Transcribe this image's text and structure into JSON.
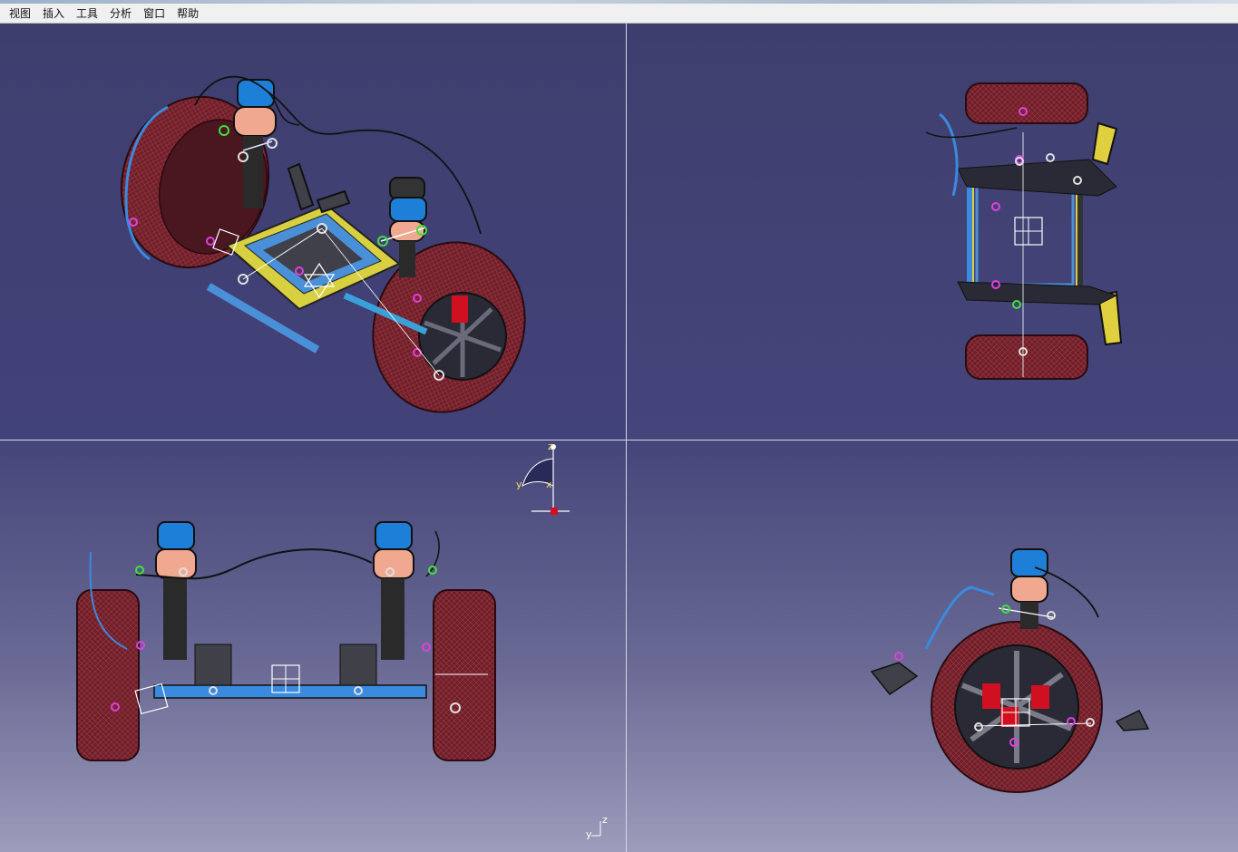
{
  "menu": {
    "items": [
      {
        "id": "view",
        "label": "视图"
      },
      {
        "id": "insert",
        "label": "插入"
      },
      {
        "id": "tools",
        "label": "工具"
      },
      {
        "id": "analyze",
        "label": "分析"
      },
      {
        "id": "window",
        "label": "窗口"
      },
      {
        "id": "help",
        "label": "帮助"
      }
    ]
  },
  "compass": {
    "z": "z",
    "y": "y",
    "x": "x"
  },
  "corner_axis": {
    "z": "z",
    "y": "y"
  },
  "colors": {
    "background_top": "#3e3e6e",
    "background_bottom": "#9c9cbc",
    "tire": "#6e1f2a",
    "coil": "#1e7fd8",
    "bushing": "#f0a890",
    "frame_yellow": "#e8e040",
    "frame_blue": "#4a90d8",
    "brake_red": "#d01020"
  },
  "icons": [
    "compass-icon",
    "corner-axis-icon"
  ]
}
